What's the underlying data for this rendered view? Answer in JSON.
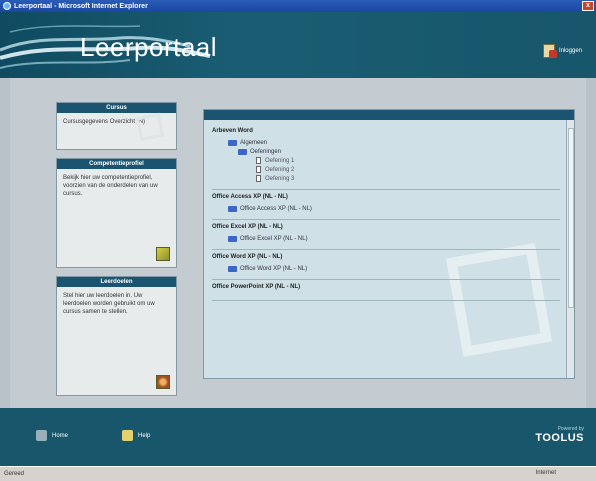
{
  "window": {
    "title": "Leerportaal - Microsoft Internet Explorer"
  },
  "header": {
    "title": "Leerportaal",
    "login_label": "Inloggen"
  },
  "sidebar": {
    "cursus": {
      "heading": "Cursus",
      "text": "Cursusgegevens Overzicht (N)"
    },
    "competentie": {
      "heading": "Competentieprofiel",
      "text": "Bekijk hier uw competentieprofiel, voorzien van de onderdelen van uw cursus."
    },
    "leerdoelen": {
      "heading": "Leerdoelen",
      "text": "Stel hier uw leerdoelen in. Uw leerdoelen worden gebruikt om uw cursus samen te stellen."
    }
  },
  "tree": {
    "sections": [
      {
        "title": "Arbeven Word",
        "items": [
          {
            "level": 1,
            "type": "folder",
            "label": "Algemeen"
          },
          {
            "level": 2,
            "type": "folder",
            "label": "Oefeningen"
          },
          {
            "level": 3,
            "type": "file",
            "label": "Oefening 1"
          },
          {
            "level": 3,
            "type": "file",
            "label": "Oefening 2"
          },
          {
            "level": 3,
            "type": "file",
            "label": "Oefening 3"
          }
        ]
      },
      {
        "title": "Office Access XP (NL - NL)",
        "items": [
          {
            "level": 1,
            "type": "folder",
            "label": "Office Access XP (NL - NL)"
          }
        ]
      },
      {
        "title": "Office Excel XP (NL - NL)",
        "items": [
          {
            "level": 1,
            "type": "folder",
            "label": "Office Excel XP (NL - NL)"
          }
        ]
      },
      {
        "title": "Office Word XP (NL - NL)",
        "items": [
          {
            "level": 1,
            "type": "folder",
            "label": "Office Word XP (NL - NL)"
          }
        ]
      },
      {
        "title": "Office PowerPoint XP (NL - NL)",
        "items": []
      }
    ]
  },
  "footer": {
    "home_label": "Home",
    "help_label": "Help",
    "powered_by": "Powered by",
    "brand": "TOOLUS"
  },
  "statusbar": {
    "left": "Gereed",
    "zone": "Internet"
  },
  "colors": {
    "header": "#17566b",
    "panel_head": "#1a5470",
    "panel_bg": "#cfe0e6"
  }
}
